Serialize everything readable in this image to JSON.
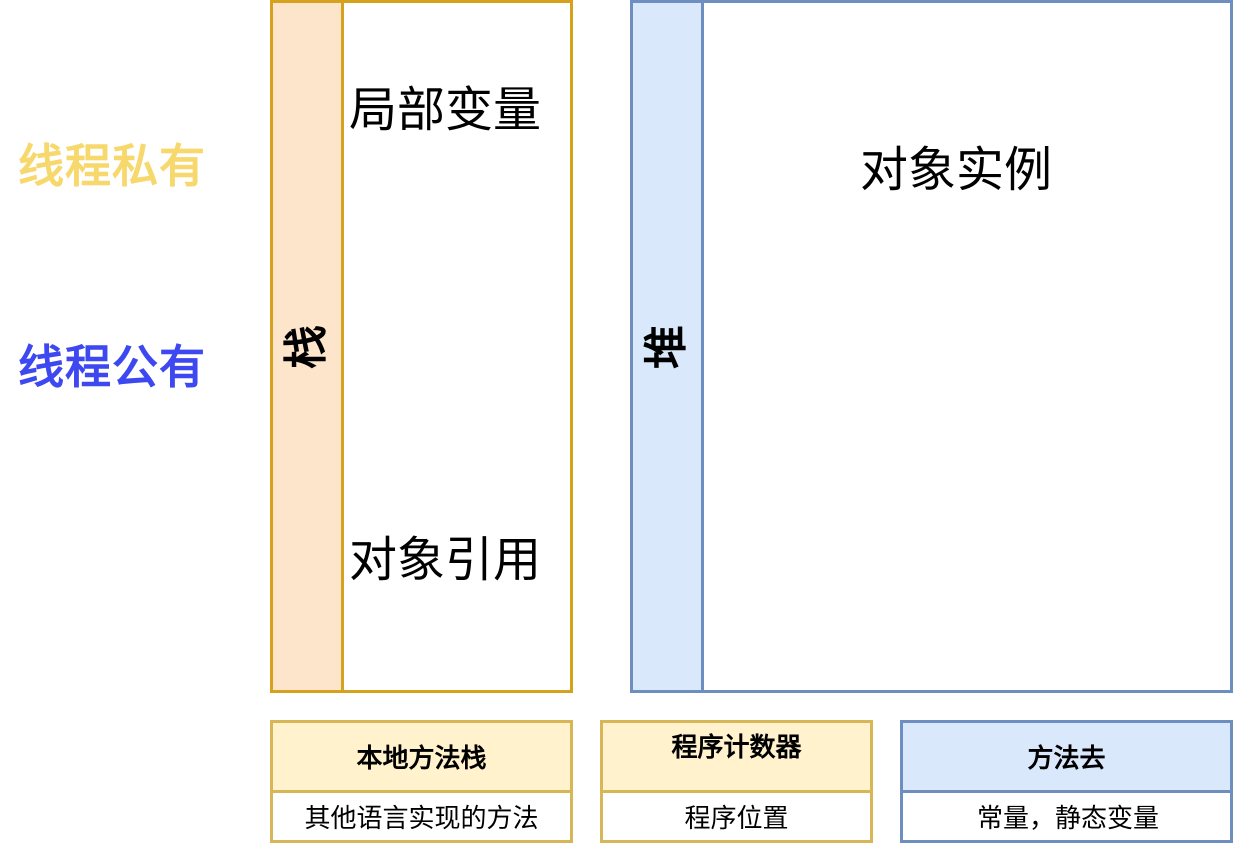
{
  "legend": {
    "private": "线程私有",
    "shared": "线程公有",
    "private_color": "#f7d86c",
    "shared_color": "#3d48f0"
  },
  "stack": {
    "label": "栈",
    "local_variables": "局部变量",
    "object_reference": "对象引用",
    "border_color": "#d6a21e",
    "fill_color": "#fde5cc"
  },
  "heap": {
    "label": "堆",
    "object_instance": "对象实例",
    "border_color": "#6d8ebf",
    "fill_color": "#dae8fc"
  },
  "native_method_stack": {
    "title": "本地方法栈",
    "description": "其他语言实现的方法"
  },
  "program_counter": {
    "title": "程序计数器",
    "description": "程序位置"
  },
  "method_area": {
    "title": "方法去",
    "description": "常量，静态变量"
  }
}
